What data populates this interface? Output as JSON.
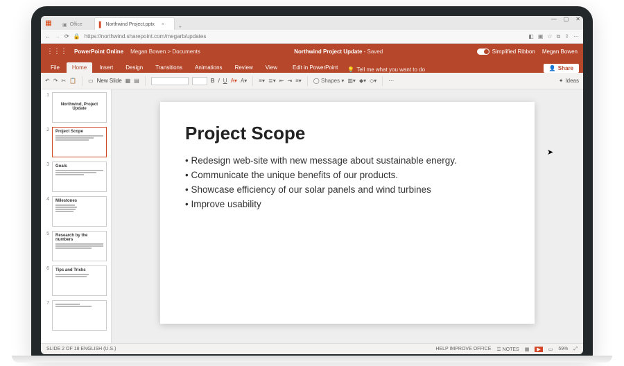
{
  "browser": {
    "tabs": [
      {
        "label": "Office",
        "icon": "office"
      },
      {
        "label": "Northwind Project.pptx",
        "icon": "ppt",
        "active": true
      }
    ],
    "url": "https://northwind.sharepoint.com/megarb/updates",
    "window_controls": {
      "min": "—",
      "max": "▢",
      "close": "✕"
    }
  },
  "titlebar": {
    "brand": "PowerPoint Online",
    "breadcrumb": "Megan Bowen > Documents",
    "doc_title": "Northwind Project Update",
    "save_state": "Saved",
    "ribbon_toggle": "Simplified Ribbon",
    "user": "Megan Bowen"
  },
  "menu": {
    "items": [
      "File",
      "Home",
      "Insert",
      "Design",
      "Transitions",
      "Animations",
      "Review",
      "View"
    ],
    "active": "Home",
    "edit_in": "Edit in PowerPoint",
    "tell_me": "Tell me what you want to do",
    "share": "Share"
  },
  "ribbon": {
    "new_slide": "New Slide",
    "font_name": "",
    "font_size": "",
    "shapes": "Shapes",
    "ideas": "Ideas"
  },
  "thumbs": [
    {
      "n": "1",
      "title": "Northwind, Project Update"
    },
    {
      "n": "2",
      "title": "Project Scope",
      "selected": true
    },
    {
      "n": "3",
      "title": "Goals"
    },
    {
      "n": "4",
      "title": "Milestones"
    },
    {
      "n": "5",
      "title": "Research by the numbers"
    },
    {
      "n": "6",
      "title": "Tips and Tricks"
    },
    {
      "n": "7",
      "title": ""
    }
  ],
  "slide": {
    "title": "Project Scope",
    "bullets": [
      "Redesign web-site with new message about sustainable energy.",
      "Communicate the unique benefits of our products.",
      "Showcase efficiency of our solar panels and wind turbines",
      "Improve usability"
    ]
  },
  "status": {
    "left": "SLIDE 2 OF 18    ENGLISH (U.S.)",
    "help": "HELP IMPROVE OFFICE",
    "notes": "NOTES",
    "zoom": "59%"
  }
}
